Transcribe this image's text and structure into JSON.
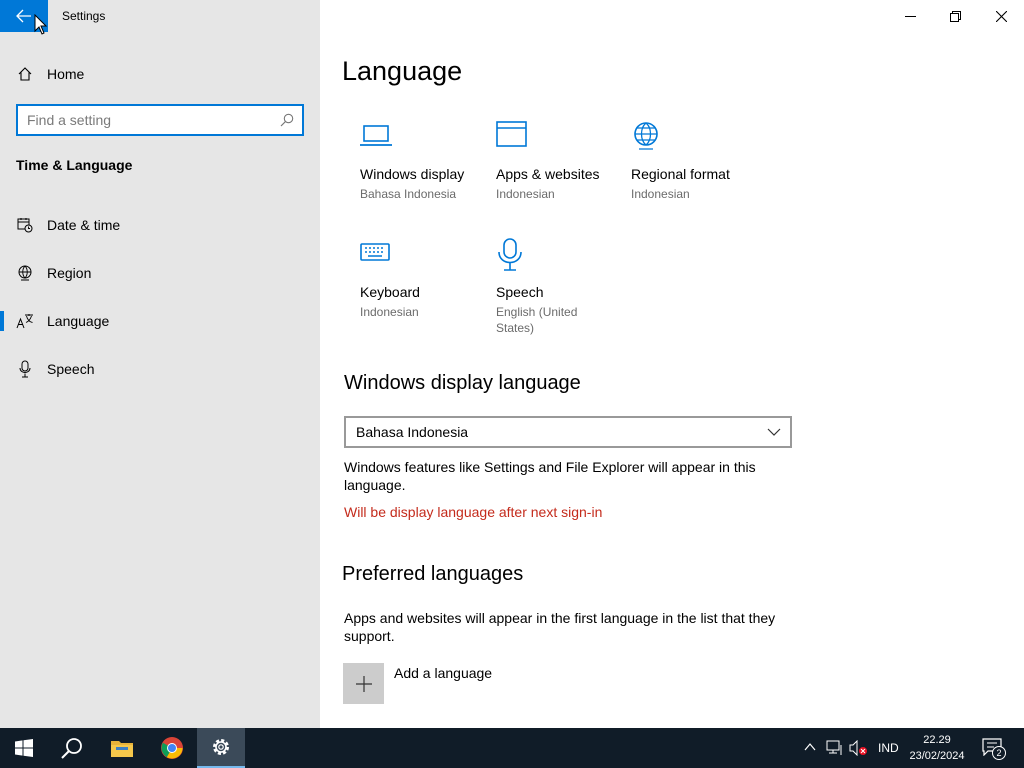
{
  "window": {
    "title": "Settings"
  },
  "sidebar": {
    "home_label": "Home",
    "search_placeholder": "Find a setting",
    "section_title": "Time & Language",
    "items": [
      {
        "label": "Date & time",
        "icon": "calendar-clock-icon"
      },
      {
        "label": "Region",
        "icon": "globe-icon"
      },
      {
        "label": "Language",
        "icon": "language-icon",
        "active": true
      },
      {
        "label": "Speech",
        "icon": "microphone-icon"
      }
    ]
  },
  "main": {
    "title": "Language",
    "tiles": [
      {
        "name": "Windows display",
        "sub": "Bahasa Indonesia",
        "icon": "laptop-icon"
      },
      {
        "name": "Apps & websites",
        "sub": "Indonesian",
        "icon": "window-icon"
      },
      {
        "name": "Regional format",
        "sub": "Indonesian",
        "icon": "globe-icon"
      },
      {
        "name": "Keyboard",
        "sub": "Indonesian",
        "icon": "keyboard-icon"
      },
      {
        "name": "Speech",
        "sub": "English (United States)",
        "icon": "microphone-icon"
      }
    ],
    "display_language": {
      "heading": "Windows display language",
      "selected": "Bahasa Indonesia",
      "description": "Windows features like Settings and File Explorer will appear in this language.",
      "warning": "Will be display language after next sign-in",
      "warning_color": "#c42b1c"
    },
    "preferred": {
      "heading": "Preferred languages",
      "description": "Apps and websites will appear in the first language in the list that they support.",
      "add_label": "Add a language"
    }
  },
  "taskbar": {
    "input_indicator": "IND",
    "time": "22.29",
    "date": "23/02/2024",
    "notification_count": "2"
  },
  "colors": {
    "accent": "#0078d7",
    "sidebar_bg": "#e6e6e6",
    "taskbar_bg": "#101c28"
  }
}
